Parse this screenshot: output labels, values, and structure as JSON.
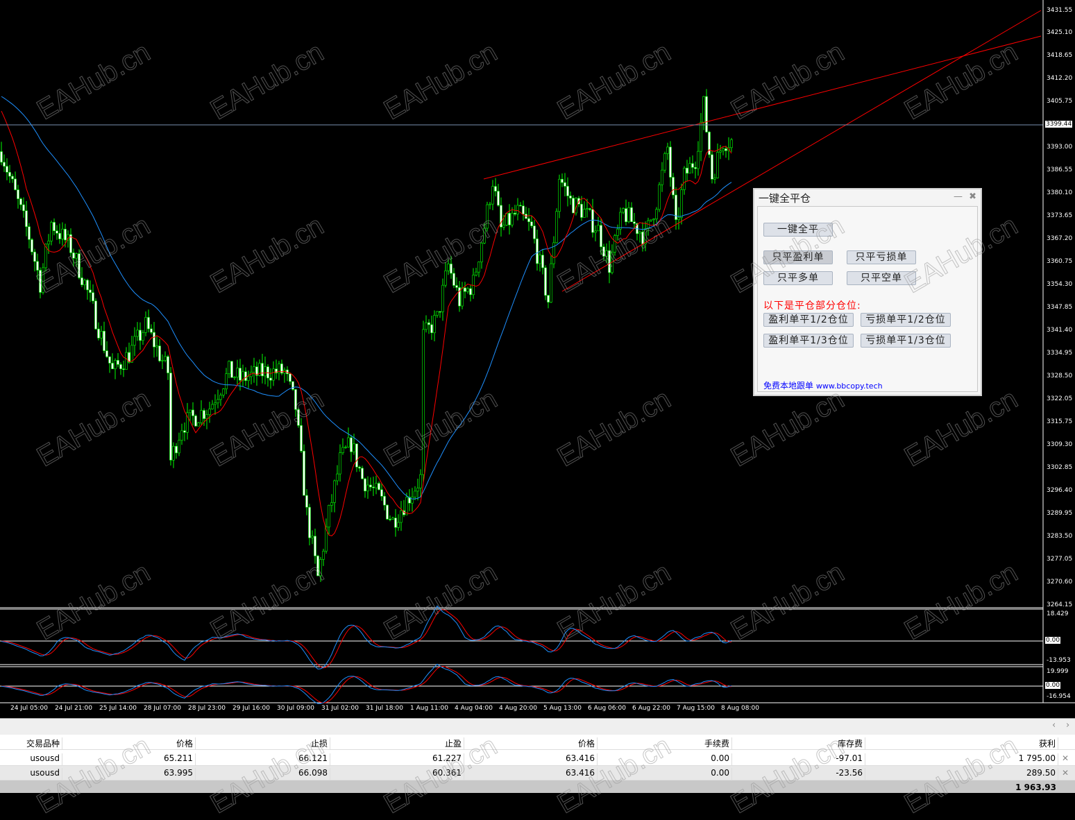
{
  "price_axis": [
    "3431.55",
    "3425.10",
    "3418.65",
    "3412.20",
    "3405.75",
    "3393.00",
    "3386.55",
    "3380.10",
    "3373.65",
    "3367.20",
    "3360.75",
    "3354.30",
    "3347.85",
    "3341.40",
    "3334.95",
    "3328.50",
    "3322.05",
    "3315.75",
    "3309.30",
    "3302.85",
    "3296.40",
    "3289.95",
    "3283.50",
    "3277.05",
    "3270.60",
    "3264.15"
  ],
  "current_price": "3399.44",
  "osc1_axis": {
    "top": "18.429",
    "zero": "0.00",
    "bottom": "-13.953"
  },
  "osc2_axis": {
    "top": "19.999",
    "zero": "0.00",
    "bottom": "-16.954"
  },
  "date_axis": [
    "24 Jul 05:00",
    "24 Jul 21:00",
    "25 Jul 14:00",
    "28 Jul 07:00",
    "28 Jul 23:00",
    "29 Jul 16:00",
    "30 Jul 09:00",
    "31 Jul 02:00",
    "31 Jul 18:00",
    "1 Aug 11:00",
    "4 Aug 04:00",
    "4 Aug 20:00",
    "5 Aug 13:00",
    "6 Aug 06:00",
    "6 Aug 22:00",
    "7 Aug 15:00",
    "8 Aug 08:00"
  ],
  "colors": {
    "bull": "#00ff00",
    "ma_fast": "#ff0000",
    "ma_slow": "#1e90ff",
    "trendline": "#ff0000",
    "osc_main": "#1e90ff",
    "osc_signal": "#ff0000"
  },
  "price_path": [
    [
      0,
      3392
    ],
    [
      5,
      3380
    ],
    [
      10,
      3368
    ],
    [
      14,
      3355
    ],
    [
      18,
      3372
    ],
    [
      25,
      3365
    ],
    [
      30,
      3355
    ],
    [
      34,
      3345
    ],
    [
      40,
      3330
    ],
    [
      46,
      3335
    ],
    [
      52,
      3343
    ],
    [
      60,
      3330
    ],
    [
      61,
      3305
    ],
    [
      65,
      3315
    ],
    [
      75,
      3320
    ],
    [
      82,
      3330
    ],
    [
      86,
      3328
    ],
    [
      95,
      3330
    ],
    [
      102,
      3330
    ],
    [
      106,
      3320
    ],
    [
      110,
      3290
    ],
    [
      114,
      3272
    ],
    [
      118,
      3290
    ],
    [
      122,
      3305
    ],
    [
      126,
      3310
    ],
    [
      130,
      3300
    ],
    [
      136,
      3295
    ],
    [
      141,
      3288
    ],
    [
      147,
      3295
    ],
    [
      151,
      3300
    ],
    [
      152,
      3340
    ],
    [
      157,
      3345
    ],
    [
      161,
      3360
    ],
    [
      165,
      3350
    ],
    [
      170,
      3355
    ],
    [
      175,
      3375
    ],
    [
      177,
      3384
    ],
    [
      180,
      3370
    ],
    [
      186,
      3375
    ],
    [
      191,
      3370
    ],
    [
      197,
      3350
    ],
    [
      201,
      3385
    ],
    [
      205,
      3378
    ],
    [
      210,
      3375
    ],
    [
      215,
      3370
    ],
    [
      219,
      3360
    ],
    [
      224,
      3375
    ],
    [
      232,
      3368
    ],
    [
      236,
      3378
    ],
    [
      240,
      3393
    ],
    [
      243,
      3370
    ],
    [
      246,
      3385
    ],
    [
      250,
      3390
    ],
    [
      253,
      3405
    ],
    [
      256,
      3385
    ],
    [
      260,
      3395
    ],
    [
      264,
      3395
    ]
  ],
  "watermark": "EAHub.cn",
  "panel": {
    "title": "一键全平仓",
    "minimize": "—",
    "close": "✖",
    "close_all": "一键全平",
    "close_profit": "只平盈利单",
    "close_loss": "只平亏损单",
    "close_long": "只平多单",
    "close_short": "只平空单",
    "partial_label": "以下是平仓部分仓位:",
    "profit_half": "盈利单平1/2仓位",
    "loss_half": "亏损单平1/2仓位",
    "profit_third": "盈利单平1/3仓位",
    "loss_third": "亏损单平1/3仓位",
    "footer_cn": "免费本地跟单",
    "footer_url": "www.bbcopy.tech"
  },
  "toolbar": {
    "prev": "‹",
    "next": "›"
  },
  "table": {
    "headers": [
      "交易品种",
      "价格",
      "止损",
      "止盈",
      "价格",
      "手续费",
      "库存费",
      "获利"
    ],
    "rows": [
      [
        "usousd",
        "65.211",
        "66.121",
        "61.227",
        "63.416",
        "0.00",
        "-97.01",
        "1 795.00"
      ],
      [
        "usousd",
        "63.995",
        "66.098",
        "60.361",
        "63.416",
        "0.00",
        "-23.56",
        "289.50"
      ]
    ],
    "close_icon": "✕",
    "total": "1 963.93"
  }
}
